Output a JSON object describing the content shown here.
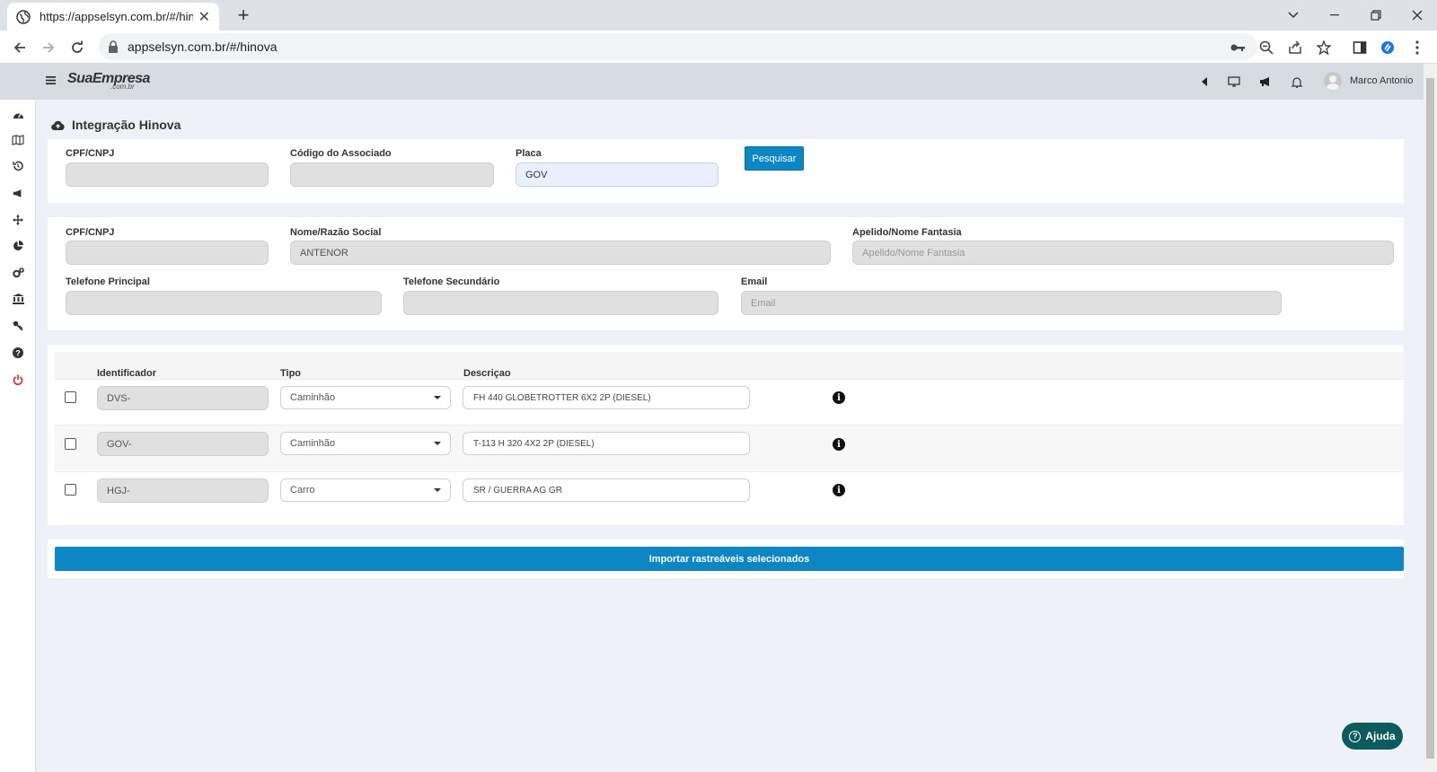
{
  "browser": {
    "tab_title": "https://appselsyn.com.br/#/hinova",
    "url": "appselsyn.com.br/#/hinova"
  },
  "app": {
    "logo": "SuaEmpresa",
    "logo_sub": ".com.br",
    "user": "Marco Antonio"
  },
  "page": {
    "title": "Integração Hinova"
  },
  "search": {
    "cpf_label": "CPF/CNPJ",
    "cpf_value": "",
    "codigo_label": "Código do Associado",
    "codigo_value": "",
    "placa_label": "Placa",
    "placa_value": "GOV",
    "button": "Pesquisar"
  },
  "associado": {
    "cpf_label": "CPF/CNPJ",
    "cpf_value": "",
    "nome_label": "Nome/Razão Social",
    "nome_value": "ANTENOR",
    "apelido_label": "Apelido/Nome Fantasia",
    "apelido_placeholder": "Apelido/Nome Fantasia",
    "tel1_label": "Telefone Principal",
    "tel1_value": "",
    "tel2_label": "Telefone Secundário",
    "tel2_value": "",
    "email_label": "Email",
    "email_placeholder": "Email"
  },
  "table": {
    "headers": [
      "Identificador",
      "Tipo",
      "Descriçao"
    ],
    "rows": [
      {
        "id": "DVS-",
        "tipo": "Caminhão",
        "descricao": "FH 440 GLOBETROTTER 6X2 2P (DIESEL)"
      },
      {
        "id": "GOV-",
        "tipo": "Caminhão",
        "descricao": "T-113 H 320 4X2 2P (DIESEL)"
      },
      {
        "id": "HGJ-",
        "tipo": "Carro",
        "descricao": "SR / GUERRA AG GR"
      }
    ]
  },
  "actions": {
    "import": "Importar rastreáveis selecionados",
    "help": "Ajuda"
  }
}
